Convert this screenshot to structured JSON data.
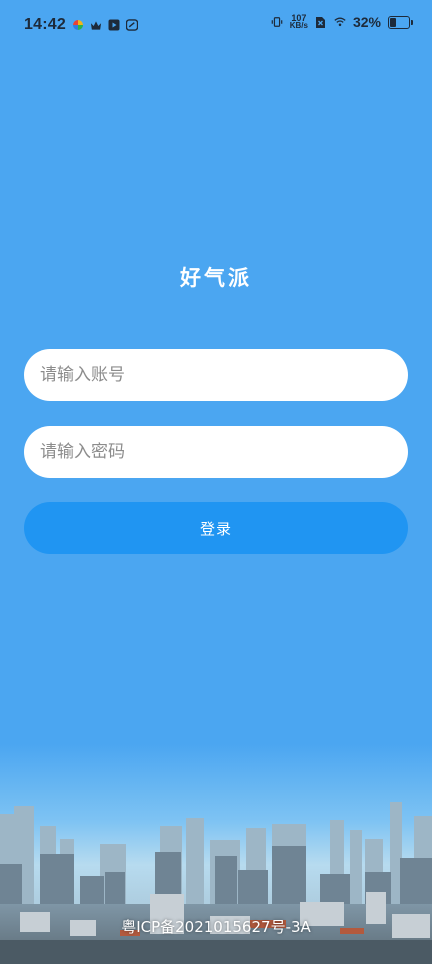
{
  "status_bar": {
    "time": "14:42",
    "net_speed_value": "107",
    "net_speed_unit": "KB/s",
    "battery_percent": "32%",
    "battery_level": 0.32,
    "icons_left": [
      "colorful-app-icon",
      "crown-icon",
      "video-icon",
      "sync-icon"
    ],
    "icons_right": [
      "vibrate-icon",
      "netspeed",
      "sim-off-icon",
      "wifi-icon",
      "battery-icon"
    ]
  },
  "app": {
    "title": "好气派"
  },
  "login": {
    "account_placeholder": "请输入账号",
    "password_placeholder": "请输入密码",
    "submit_label": "登录"
  },
  "footer": {
    "icp": "粤ICP备2021015627号-3A"
  },
  "colors": {
    "background": "#4ba6f1",
    "button": "#2095f2",
    "input_bg": "#ffffff"
  }
}
